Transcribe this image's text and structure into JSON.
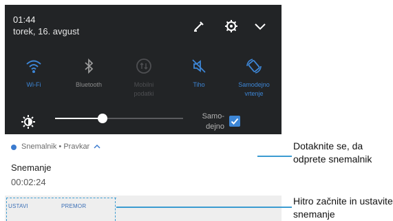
{
  "status": {
    "time": "01:44",
    "date": "torek, 16. avgust"
  },
  "header_icons": [
    "edit-icon",
    "gear-icon",
    "chevron-down-icon"
  ],
  "tiles": [
    {
      "id": "wifi",
      "label": "Wi-Fi",
      "state": "on",
      "icon": "wifi-icon"
    },
    {
      "id": "bluetooth",
      "label": "Bluetooth",
      "state": "off",
      "icon": "bluetooth-icon"
    },
    {
      "id": "mobile-data",
      "label": "Mobilni podatki",
      "state": "disabled",
      "icon": "mobile-data-icon"
    },
    {
      "id": "silent",
      "label": "Tiho",
      "state": "on",
      "icon": "mute-icon"
    },
    {
      "id": "auto-rotate",
      "label": "Samodejno vrtenje",
      "state": "on",
      "icon": "rotate-icon"
    }
  ],
  "brightness": {
    "level": 0.37,
    "auto_label": "Samo-dejno",
    "auto_checked": true
  },
  "notification": {
    "app_line": "Snemalnik • Pravkar",
    "title": "Snemanje",
    "timer": "00:02:24",
    "actions": [
      "USTAVI",
      "PREMOR"
    ]
  },
  "callouts": {
    "open_recorder": "Dotaknite se, da odprete snemalnik",
    "quick_controls": "Hitro začnite in ustavite snemanje"
  },
  "colors": {
    "shade_bg": "#222426",
    "accent": "#3d86d6",
    "callout_line": "#3b9bd1"
  }
}
